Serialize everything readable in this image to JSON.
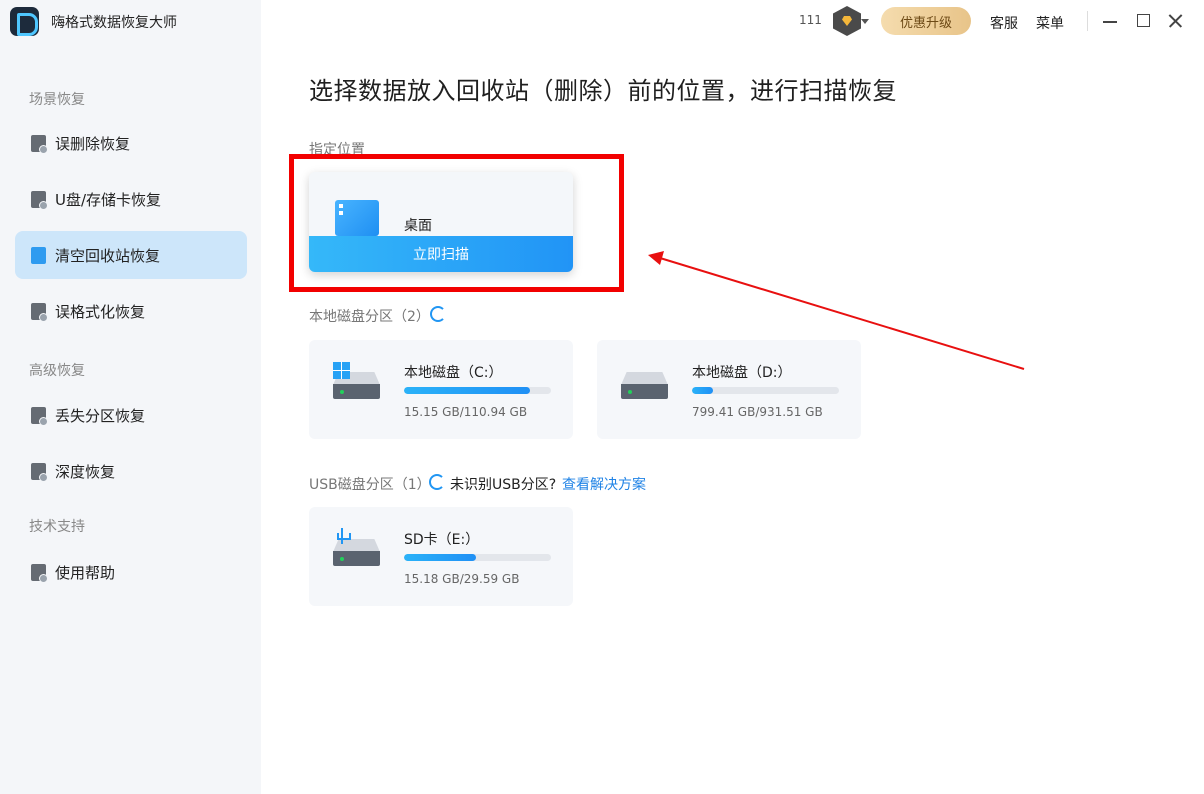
{
  "app": {
    "name": "嗨格式数据恢复大师"
  },
  "sidebar": {
    "sections": [
      "场景恢复",
      "高级恢复",
      "技术支持"
    ],
    "items": [
      {
        "label": "误删除恢复",
        "icon": "file-delete-icon",
        "active": false
      },
      {
        "label": "U盘/存储卡恢复",
        "icon": "usb-drive-icon",
        "active": false
      },
      {
        "label": "清空回收站恢复",
        "icon": "recycle-bin-icon",
        "active": true
      },
      {
        "label": "误格式化恢复",
        "icon": "format-brush-icon",
        "active": false
      },
      {
        "label": "丢失分区恢复",
        "icon": "partition-icon",
        "active": false
      },
      {
        "label": "深度恢复",
        "icon": "deep-scan-icon",
        "active": false
      },
      {
        "label": "使用帮助",
        "icon": "help-book-icon",
        "active": false
      }
    ]
  },
  "topbar": {
    "count": "111",
    "upgrade_label": "优惠升级",
    "service_label": "客服",
    "menu_label": "菜单"
  },
  "main": {
    "title": "选择数据放入回收站（删除）前的位置，进行扫描恢复",
    "location_label": "指定位置",
    "desktop": {
      "name": "桌面",
      "scan_label": "立即扫描"
    },
    "local_label": "本地磁盘分区（2）",
    "local_drives": [
      {
        "name": "本地磁盘（C:）",
        "size": "15.15 GB/110.94 GB",
        "used_fraction": 0.86
      },
      {
        "name": "本地磁盘（D:）",
        "size": "799.41 GB/931.51 GB",
        "used_fraction": 0.14
      }
    ],
    "usb_label": "USB磁盘分区（1）",
    "usb_note": "未识别USB分区?",
    "usb_link": "查看解决方案",
    "usb_drives": [
      {
        "name": "SD卡（E:）",
        "size": "15.18 GB/29.59 GB",
        "used_fraction": 0.49
      }
    ]
  },
  "colors": {
    "accent": "#2196f3",
    "highlight": "#f20000",
    "active_bg": "#cde6fa"
  }
}
